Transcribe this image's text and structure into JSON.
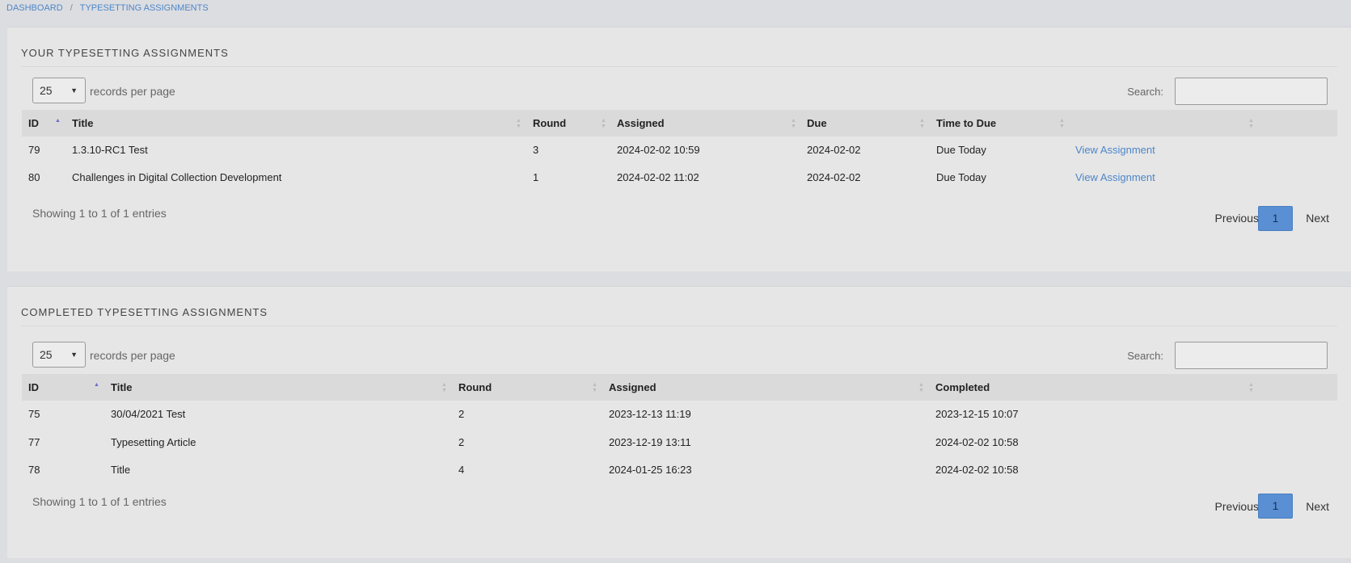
{
  "breadcrumb": [
    "DASHBOARD",
    "/",
    "TYPESETTING ASSIGNMENTS"
  ],
  "current": {
    "title": "YOUR TYPESETTING ASSIGNMENTS",
    "length": {
      "value": "25",
      "label": "records per page"
    },
    "search_label": "Search:",
    "columns": [
      "ID",
      "Title",
      "Round",
      "Assigned",
      "Due",
      "Time to Due",
      ""
    ],
    "rows": [
      [
        "79",
        "1.3.10-RC1 Test",
        "3",
        "2024-02-02 10:59",
        "2024-02-02",
        "Due Today",
        "View Assignment"
      ],
      [
        "80",
        "Challenges in Digital Collection Development",
        "1",
        "2024-02-02 11:02",
        "2024-02-02",
        "Due Today",
        "View Assignment"
      ]
    ],
    "info": "Showing 1 to 1 of 1 entries",
    "pagination": {
      "previous": "Previous",
      "page": "1",
      "next": "Next"
    }
  },
  "completed": {
    "title": "COMPLETED TYPESETTING ASSIGNMENTS",
    "length": {
      "value": "25",
      "label": "records per page"
    },
    "search_label": "Search:",
    "columns": [
      "ID",
      "Title",
      "Round",
      "Assigned",
      "Completed"
    ],
    "rows": [
      [
        "75",
        "30/04/2021 Test",
        "2",
        "2023-12-13 11:19",
        "2023-12-15 10:07"
      ],
      [
        "77",
        "Typesetting Article",
        "2",
        "2023-12-19 13:11",
        "2024-02-02 10:58"
      ],
      [
        "78",
        "Title",
        "4",
        "2024-01-25 16:23",
        "2024-02-02 10:58"
      ]
    ],
    "info": "Showing 1 to 1 of 1 entries",
    "pagination": {
      "previous": "Previous",
      "page": "1",
      "next": "Next"
    }
  },
  "colors": {
    "link": "#4d86c9",
    "active_page": "#5a8fd3",
    "sort_active": "#6a6aca"
  },
  "icons": {
    "sort_asc": "sort-asc-icon",
    "sort_both": "sort-both-icon",
    "dropdown": "chevron-down-icon"
  }
}
